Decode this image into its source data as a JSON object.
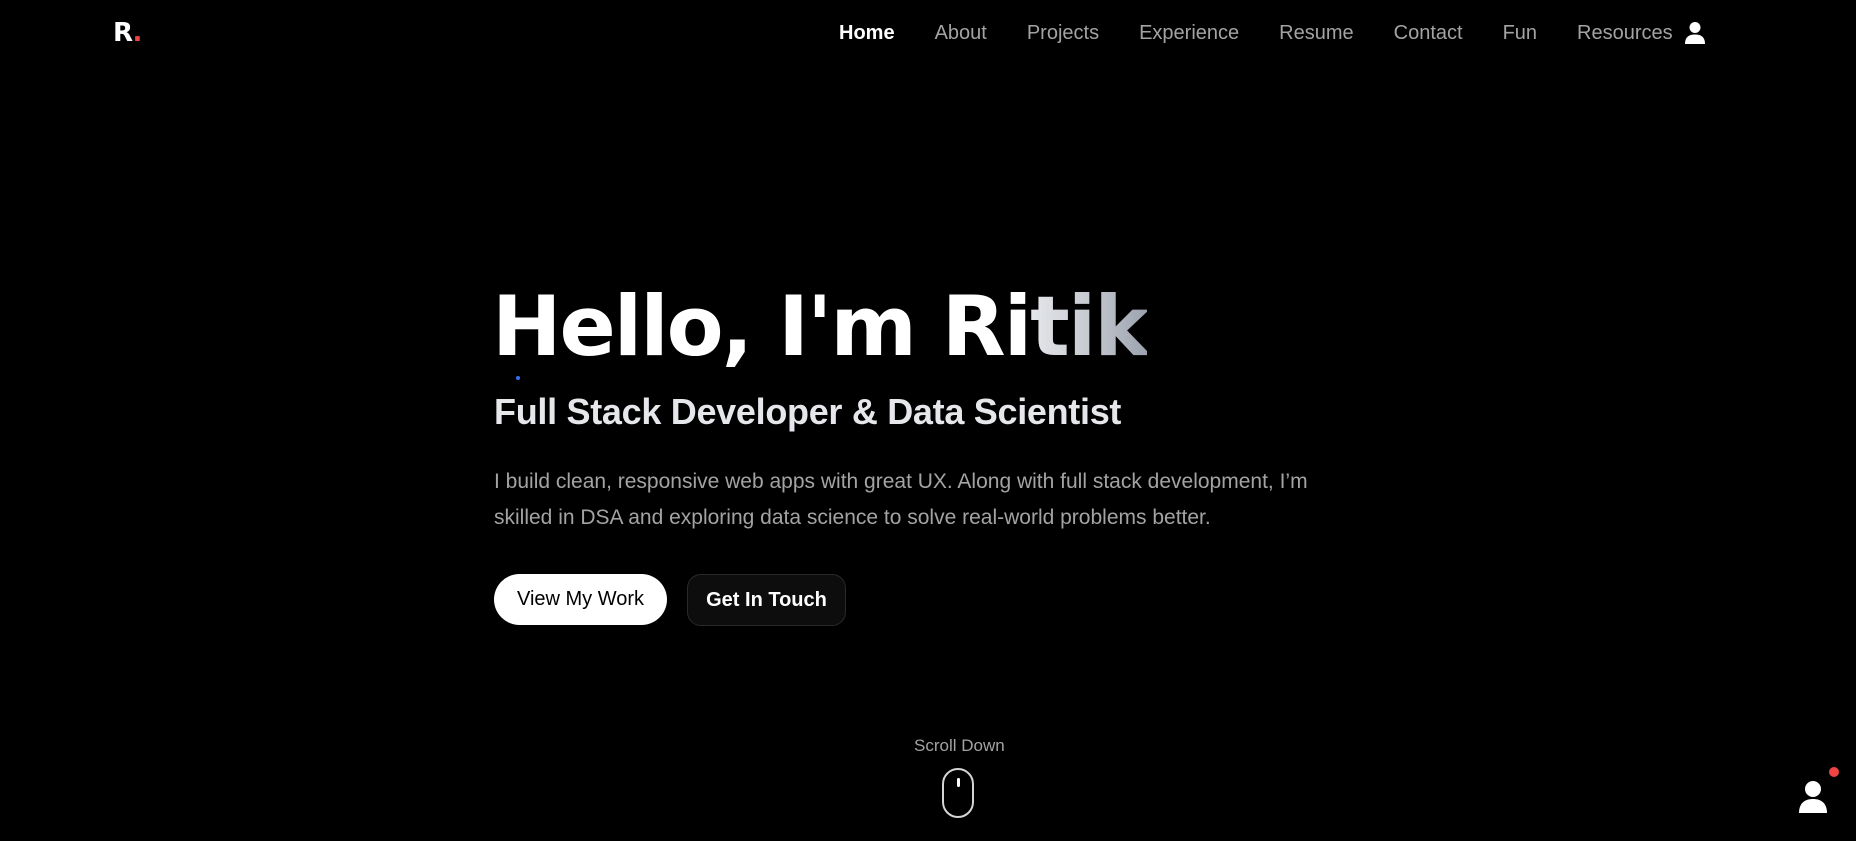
{
  "logo": {
    "letter": "R",
    "dot": "."
  },
  "nav": {
    "items": [
      {
        "label": "Home",
        "active": true
      },
      {
        "label": "About"
      },
      {
        "label": "Projects"
      },
      {
        "label": "Experience"
      },
      {
        "label": "Resume"
      },
      {
        "label": "Contact"
      },
      {
        "label": "Fun"
      },
      {
        "label": "Resources"
      }
    ],
    "user_icon": "user-icon"
  },
  "hero": {
    "title_part1": "Hello, I'm Ri",
    "title_part2": "tik",
    "subtitle": "Full Stack Developer & Data Scientist",
    "description": "I build clean, responsive web apps with great UX. Along with full stack development, I’m skilled in DSA and exploring data science to solve real-world problems better.",
    "primary_button": "View My Work",
    "secondary_button": "Get In Touch"
  },
  "scroll": {
    "label": "Scroll Down",
    "icon": "mouse-icon"
  },
  "floating": {
    "icon": "user-icon",
    "badge": "notification-dot"
  },
  "colors": {
    "background": "#000000",
    "accent_red": "#ef4444",
    "muted_text": "#a3a3a3",
    "cursor_blue": "#3b6cf6"
  }
}
